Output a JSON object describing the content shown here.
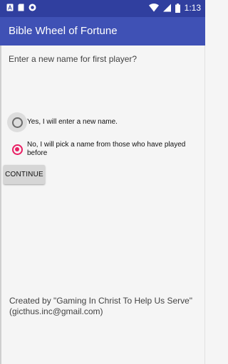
{
  "status_bar": {
    "time": "1:13",
    "icons": [
      "a-notification-icon",
      "sd-card-icon",
      "circle-icon",
      "wifi-icon",
      "cell-signal-icon",
      "battery-icon"
    ]
  },
  "app_bar": {
    "title": "Bible Wheel of Fortune",
    "color": "#3f51b5",
    "status_color": "#303f9f"
  },
  "main": {
    "prompt": "Enter a new name for first player?",
    "options": [
      {
        "label": "Yes, I will enter a new name.",
        "checked": false
      },
      {
        "label": "No, I will pick a name from those who have played before",
        "checked": true
      }
    ],
    "continue_label": "CONTINUE",
    "accent": "#e91e63"
  },
  "footer": {
    "credits": "Created by \"Gaming In Christ To Help Us Serve\" (gicthus.inc@gmail.com)"
  }
}
